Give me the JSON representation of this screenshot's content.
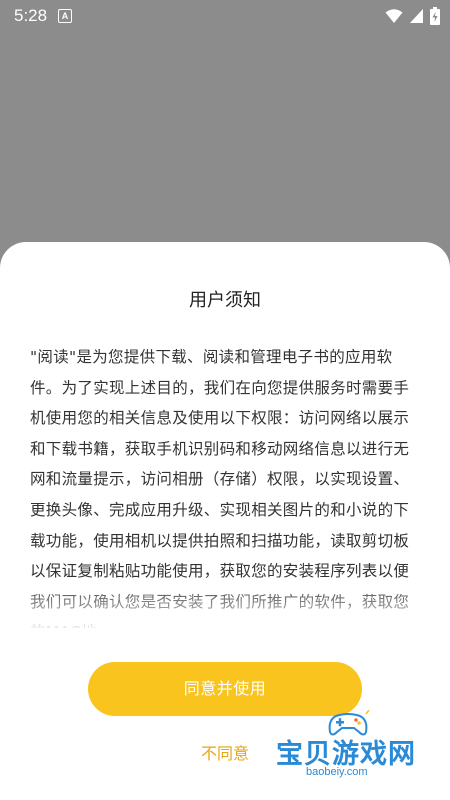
{
  "status_bar": {
    "time": "5:28",
    "notification_glyph": "A",
    "icons": [
      "wifi-icon",
      "signal-icon",
      "battery-icon"
    ],
    "color": "#ffffff"
  },
  "sheet": {
    "title": "用户须知",
    "body": "\"阅读\"是为您提供下载、阅读和管理电子书的应用软件。为了实现上述目的，我们在向您提供服务时需要手机使用您的相关信息及使用以下权限：访问网络以展示和下载书籍，获取手机识别码和移动网络信息以进行无网和流量提示，访问相册（存储）权限，以实现设置、更换头像、完成应用升级、实现相关图片的和小说的下载功能，使用相机以提供拍照和扫描功能，读取剪切板以保证复制粘贴功能使用，获取您的安装程序列表以便我们可以确认您是否安装了我们所推广的软件，获取您的MAC地",
    "agree_label": "同意并使用",
    "disagree_label": "不同意"
  },
  "watermark": {
    "text": "宝贝游戏网",
    "url": "baobeiy.com",
    "icon": "gamepad-icon"
  },
  "colors": {
    "backdrop": "#8c8c8c",
    "accent": "#f9c41d",
    "disagree_text": "#e6a510",
    "watermark": "#2a8ad6"
  }
}
